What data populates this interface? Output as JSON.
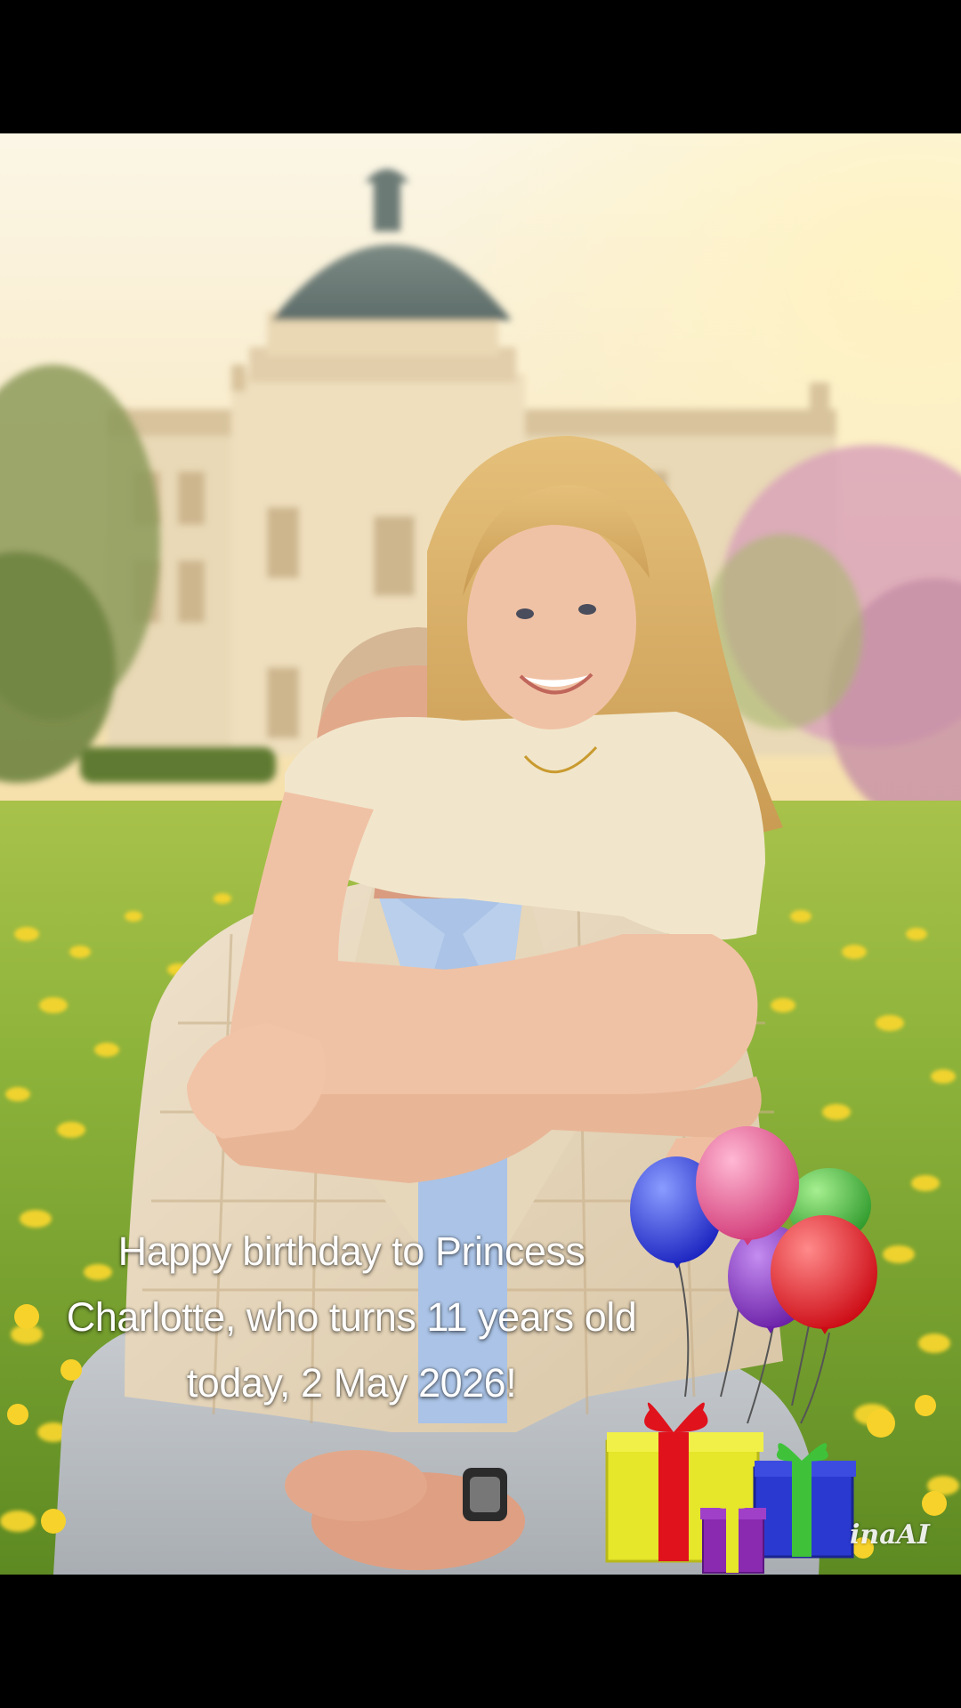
{
  "post": {
    "caption": "Happy birthday to Princess Charlotte, who turns 11 years old today, 2 May 2026!",
    "watermark": "inaAI"
  },
  "colors": {
    "letterbox": "#000000",
    "sky": "#fbf3dc",
    "meadow": "#7fae2e",
    "flowers": "#f5cf2a",
    "balloon_blue": "#2233d8",
    "balloon_pink": "#e04a8a",
    "balloon_green": "#3fae3a",
    "balloon_purple": "#7a2ab8",
    "balloon_red": "#e0121c",
    "gift_yellow": "#e6e62a",
    "gift_blue": "#2a3ad0",
    "gift_purple": "#8a2ab0"
  },
  "icons": {
    "balloons": "balloons-sticker-icon",
    "gifts": "gift-boxes-sticker-icon"
  }
}
